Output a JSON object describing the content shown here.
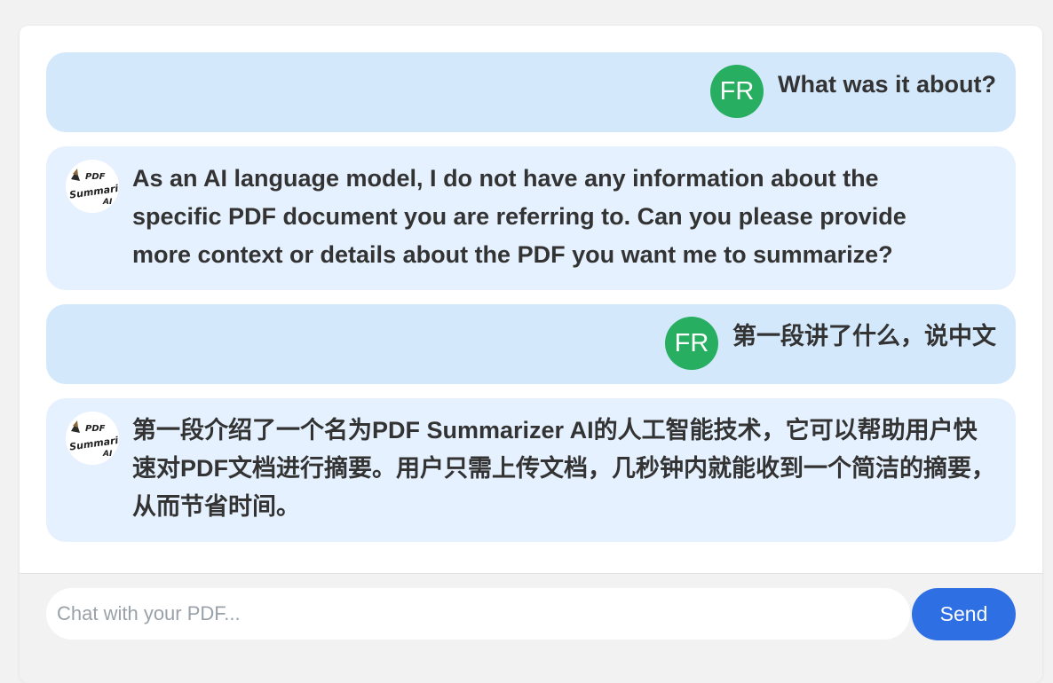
{
  "conversation": [
    {
      "role": "user",
      "avatar_initials": "FR",
      "text": "What was it about?"
    },
    {
      "role": "bot",
      "avatar_logo": "PDF Summarizer AI logo",
      "text": "As an AI language model, I do not have any information about the specific PDF document you are referring to. Can you please provide more context or details about the PDF you want me to summarize?"
    },
    {
      "role": "user",
      "avatar_initials": "FR",
      "text": "第一段讲了什么，说中文"
    },
    {
      "role": "bot",
      "avatar_logo": "PDF Summarizer AI logo",
      "text": "第一段介绍了一个名为PDF Summarizer AI的人工智能技术，它可以帮助用户快速对PDF文档进行摘要。用户只需上传文档，几秒钟内就能收到一个简洁的摘要，从而节省时间。"
    }
  ],
  "composer": {
    "input_value": "",
    "input_placeholder": "Chat with your PDF...",
    "send_label": "Send"
  },
  "colors": {
    "user_bubble": "#d4e8fc",
    "bot_bubble": "#e5f1fe",
    "user_avatar": "#27ae60",
    "send_button": "#2f6fe4"
  }
}
